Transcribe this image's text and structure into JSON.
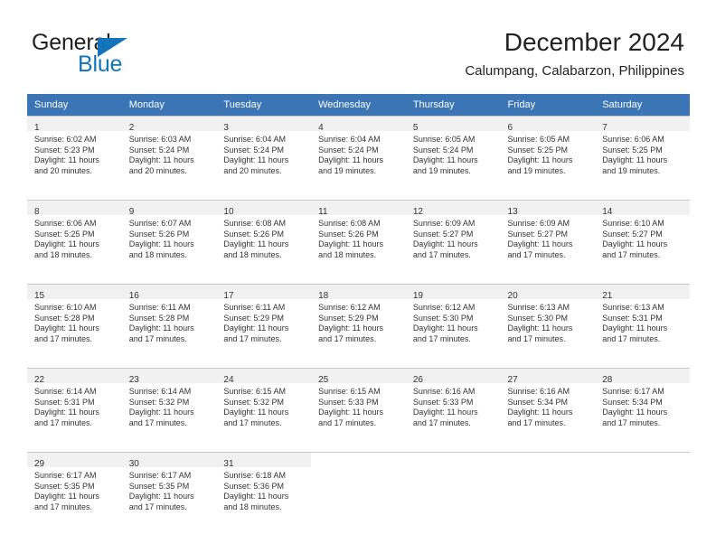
{
  "brand": {
    "line1": "General",
    "line2": "Blue",
    "triangle_color": "#1274bb",
    "text_color": "#231f20"
  },
  "header": {
    "title": "December 2024",
    "subtitle": "Calumpang, Calabarzon, Philippines"
  },
  "calendar": {
    "header_bg": "#3b75b5",
    "header_text_color": "#ffffff",
    "daynum_band_bg": "#f1f1f1",
    "weekdays": [
      "Sunday",
      "Monday",
      "Tuesday",
      "Wednesday",
      "Thursday",
      "Friday",
      "Saturday"
    ],
    "weeks": [
      [
        {
          "day": "1",
          "sunrise": "Sunrise: 6:02 AM",
          "sunset": "Sunset: 5:23 PM",
          "daylight_1": "Daylight: 11 hours",
          "daylight_2": "and 20 minutes."
        },
        {
          "day": "2",
          "sunrise": "Sunrise: 6:03 AM",
          "sunset": "Sunset: 5:24 PM",
          "daylight_1": "Daylight: 11 hours",
          "daylight_2": "and 20 minutes."
        },
        {
          "day": "3",
          "sunrise": "Sunrise: 6:04 AM",
          "sunset": "Sunset: 5:24 PM",
          "daylight_1": "Daylight: 11 hours",
          "daylight_2": "and 20 minutes."
        },
        {
          "day": "4",
          "sunrise": "Sunrise: 6:04 AM",
          "sunset": "Sunset: 5:24 PM",
          "daylight_1": "Daylight: 11 hours",
          "daylight_2": "and 19 minutes."
        },
        {
          "day": "5",
          "sunrise": "Sunrise: 6:05 AM",
          "sunset": "Sunset: 5:24 PM",
          "daylight_1": "Daylight: 11 hours",
          "daylight_2": "and 19 minutes."
        },
        {
          "day": "6",
          "sunrise": "Sunrise: 6:05 AM",
          "sunset": "Sunset: 5:25 PM",
          "daylight_1": "Daylight: 11 hours",
          "daylight_2": "and 19 minutes."
        },
        {
          "day": "7",
          "sunrise": "Sunrise: 6:06 AM",
          "sunset": "Sunset: 5:25 PM",
          "daylight_1": "Daylight: 11 hours",
          "daylight_2": "and 19 minutes."
        }
      ],
      [
        {
          "day": "8",
          "sunrise": "Sunrise: 6:06 AM",
          "sunset": "Sunset: 5:25 PM",
          "daylight_1": "Daylight: 11 hours",
          "daylight_2": "and 18 minutes."
        },
        {
          "day": "9",
          "sunrise": "Sunrise: 6:07 AM",
          "sunset": "Sunset: 5:26 PM",
          "daylight_1": "Daylight: 11 hours",
          "daylight_2": "and 18 minutes."
        },
        {
          "day": "10",
          "sunrise": "Sunrise: 6:08 AM",
          "sunset": "Sunset: 5:26 PM",
          "daylight_1": "Daylight: 11 hours",
          "daylight_2": "and 18 minutes."
        },
        {
          "day": "11",
          "sunrise": "Sunrise: 6:08 AM",
          "sunset": "Sunset: 5:26 PM",
          "daylight_1": "Daylight: 11 hours",
          "daylight_2": "and 18 minutes."
        },
        {
          "day": "12",
          "sunrise": "Sunrise: 6:09 AM",
          "sunset": "Sunset: 5:27 PM",
          "daylight_1": "Daylight: 11 hours",
          "daylight_2": "and 17 minutes."
        },
        {
          "day": "13",
          "sunrise": "Sunrise: 6:09 AM",
          "sunset": "Sunset: 5:27 PM",
          "daylight_1": "Daylight: 11 hours",
          "daylight_2": "and 17 minutes."
        },
        {
          "day": "14",
          "sunrise": "Sunrise: 6:10 AM",
          "sunset": "Sunset: 5:27 PM",
          "daylight_1": "Daylight: 11 hours",
          "daylight_2": "and 17 minutes."
        }
      ],
      [
        {
          "day": "15",
          "sunrise": "Sunrise: 6:10 AM",
          "sunset": "Sunset: 5:28 PM",
          "daylight_1": "Daylight: 11 hours",
          "daylight_2": "and 17 minutes."
        },
        {
          "day": "16",
          "sunrise": "Sunrise: 6:11 AM",
          "sunset": "Sunset: 5:28 PM",
          "daylight_1": "Daylight: 11 hours",
          "daylight_2": "and 17 minutes."
        },
        {
          "day": "17",
          "sunrise": "Sunrise: 6:11 AM",
          "sunset": "Sunset: 5:29 PM",
          "daylight_1": "Daylight: 11 hours",
          "daylight_2": "and 17 minutes."
        },
        {
          "day": "18",
          "sunrise": "Sunrise: 6:12 AM",
          "sunset": "Sunset: 5:29 PM",
          "daylight_1": "Daylight: 11 hours",
          "daylight_2": "and 17 minutes."
        },
        {
          "day": "19",
          "sunrise": "Sunrise: 6:12 AM",
          "sunset": "Sunset: 5:30 PM",
          "daylight_1": "Daylight: 11 hours",
          "daylight_2": "and 17 minutes."
        },
        {
          "day": "20",
          "sunrise": "Sunrise: 6:13 AM",
          "sunset": "Sunset: 5:30 PM",
          "daylight_1": "Daylight: 11 hours",
          "daylight_2": "and 17 minutes."
        },
        {
          "day": "21",
          "sunrise": "Sunrise: 6:13 AM",
          "sunset": "Sunset: 5:31 PM",
          "daylight_1": "Daylight: 11 hours",
          "daylight_2": "and 17 minutes."
        }
      ],
      [
        {
          "day": "22",
          "sunrise": "Sunrise: 6:14 AM",
          "sunset": "Sunset: 5:31 PM",
          "daylight_1": "Daylight: 11 hours",
          "daylight_2": "and 17 minutes."
        },
        {
          "day": "23",
          "sunrise": "Sunrise: 6:14 AM",
          "sunset": "Sunset: 5:32 PM",
          "daylight_1": "Daylight: 11 hours",
          "daylight_2": "and 17 minutes."
        },
        {
          "day": "24",
          "sunrise": "Sunrise: 6:15 AM",
          "sunset": "Sunset: 5:32 PM",
          "daylight_1": "Daylight: 11 hours",
          "daylight_2": "and 17 minutes."
        },
        {
          "day": "25",
          "sunrise": "Sunrise: 6:15 AM",
          "sunset": "Sunset: 5:33 PM",
          "daylight_1": "Daylight: 11 hours",
          "daylight_2": "and 17 minutes."
        },
        {
          "day": "26",
          "sunrise": "Sunrise: 6:16 AM",
          "sunset": "Sunset: 5:33 PM",
          "daylight_1": "Daylight: 11 hours",
          "daylight_2": "and 17 minutes."
        },
        {
          "day": "27",
          "sunrise": "Sunrise: 6:16 AM",
          "sunset": "Sunset: 5:34 PM",
          "daylight_1": "Daylight: 11 hours",
          "daylight_2": "and 17 minutes."
        },
        {
          "day": "28",
          "sunrise": "Sunrise: 6:17 AM",
          "sunset": "Sunset: 5:34 PM",
          "daylight_1": "Daylight: 11 hours",
          "daylight_2": "and 17 minutes."
        }
      ],
      [
        {
          "day": "29",
          "sunrise": "Sunrise: 6:17 AM",
          "sunset": "Sunset: 5:35 PM",
          "daylight_1": "Daylight: 11 hours",
          "daylight_2": "and 17 minutes."
        },
        {
          "day": "30",
          "sunrise": "Sunrise: 6:17 AM",
          "sunset": "Sunset: 5:35 PM",
          "daylight_1": "Daylight: 11 hours",
          "daylight_2": "and 17 minutes."
        },
        {
          "day": "31",
          "sunrise": "Sunrise: 6:18 AM",
          "sunset": "Sunset: 5:36 PM",
          "daylight_1": "Daylight: 11 hours",
          "daylight_2": "and 18 minutes."
        },
        null,
        null,
        null,
        null
      ]
    ]
  }
}
